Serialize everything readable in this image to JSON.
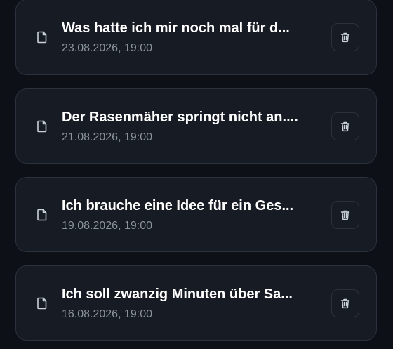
{
  "chats": [
    {
      "title": "Was hatte ich mir noch mal für d...",
      "date": "23.08.2026, 19:00"
    },
    {
      "title": "Der Rasenmäher springt nicht an....",
      "date": "21.08.2026, 19:00"
    },
    {
      "title": "Ich brauche eine Idee für ein Ges...",
      "date": "19.08.2026, 19:00"
    },
    {
      "title": "Ich soll zwanzig Minuten über Sa...",
      "date": "16.08.2026, 19:00"
    }
  ],
  "icons": {
    "item_icon": "document-icon",
    "delete_icon": "trash-icon"
  },
  "colors": {
    "background": "#0d1117",
    "card": "#161b24",
    "border": "#2b323d",
    "title": "#ffffff",
    "date": "#8b949e",
    "icon": "#c9d1d9"
  }
}
